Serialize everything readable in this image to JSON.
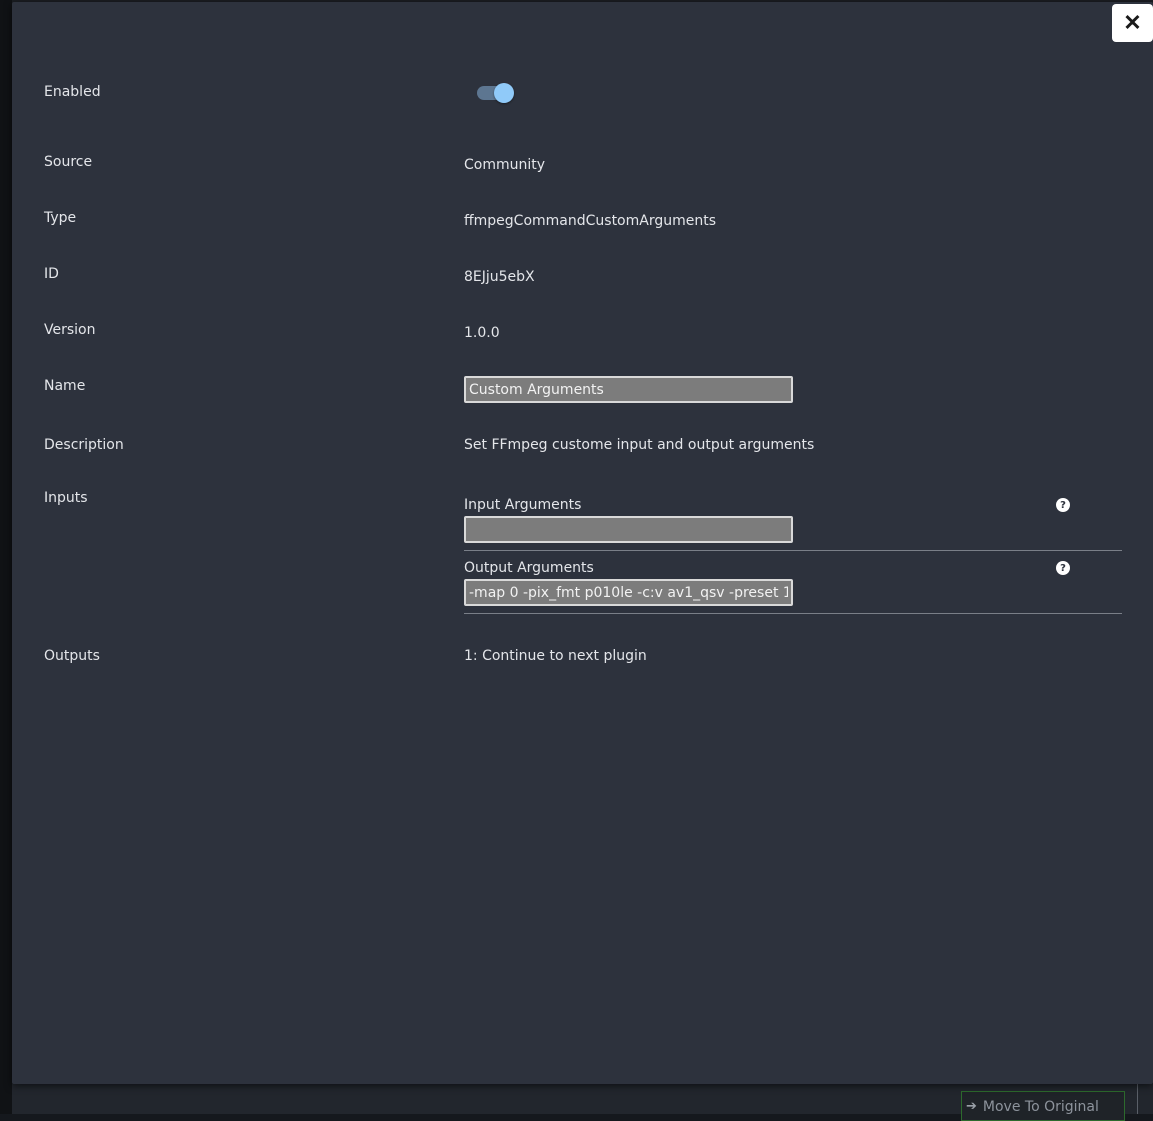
{
  "modal": {
    "close_label": "✕",
    "fields": {
      "enabled_label": "Enabled",
      "enabled_value": true,
      "source_label": "Source",
      "source_value": "Community",
      "type_label": "Type",
      "type_value": "ffmpegCommandCustomArguments",
      "id_label": "ID",
      "id_value": "8EJju5ebX",
      "version_label": "Version",
      "version_value": "1.0.0",
      "name_label": "Name",
      "name_value": "Custom Arguments",
      "description_label": "Description",
      "description_value": "Set FFmpeg custome input and output arguments",
      "inputs_label": "Inputs",
      "outputs_label": "Outputs",
      "outputs_value": "1: Continue to next plugin"
    },
    "inputs": [
      {
        "label": "Input Arguments",
        "value": "",
        "help": "?"
      },
      {
        "label": "Output Arguments",
        "value": "-map 0 -pix_fmt p010le -c:v av1_qsv -preset 1",
        "help": "?"
      }
    ]
  },
  "background": {
    "move_button_label": "Move To Original",
    "move_button_icon": "arrow-right-icon"
  }
}
